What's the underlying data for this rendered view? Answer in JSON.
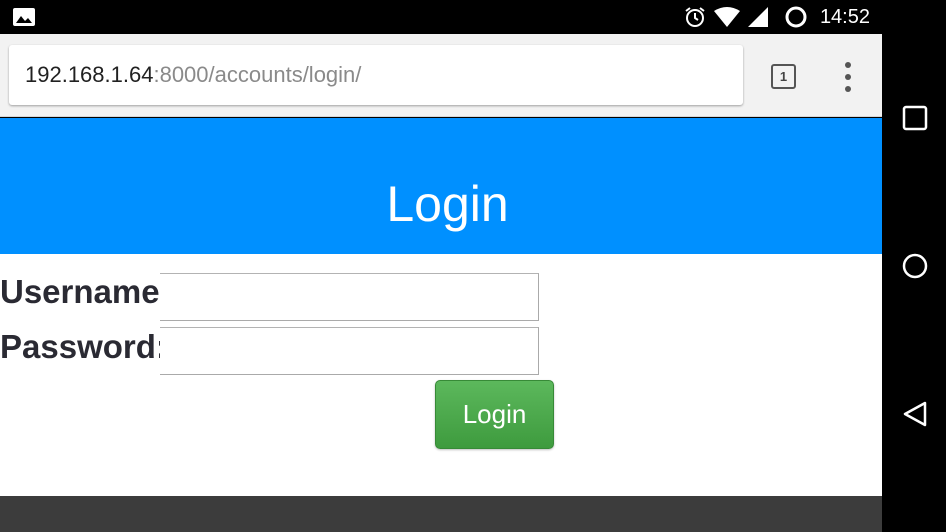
{
  "status_bar": {
    "time": "14:52",
    "icons": [
      "image-icon",
      "alarm-icon",
      "wifi-icon",
      "signal-icon",
      "battery-loading-icon"
    ]
  },
  "browser": {
    "url_host": "192.168.1.64",
    "url_path": ":8000/accounts/login/",
    "tab_count": "1",
    "menu_icon": "more-vert-icon"
  },
  "page": {
    "title": "Login",
    "username_label": "Username:",
    "password_label": "Password:",
    "username_value": "",
    "password_value": "",
    "login_button_label": "Login"
  },
  "nav_bar": {
    "buttons": [
      "recents-icon",
      "home-icon",
      "back-icon"
    ]
  },
  "colors": {
    "header": "#0090ff",
    "button": "#4cae4c",
    "footer": "#3c3c3c"
  }
}
